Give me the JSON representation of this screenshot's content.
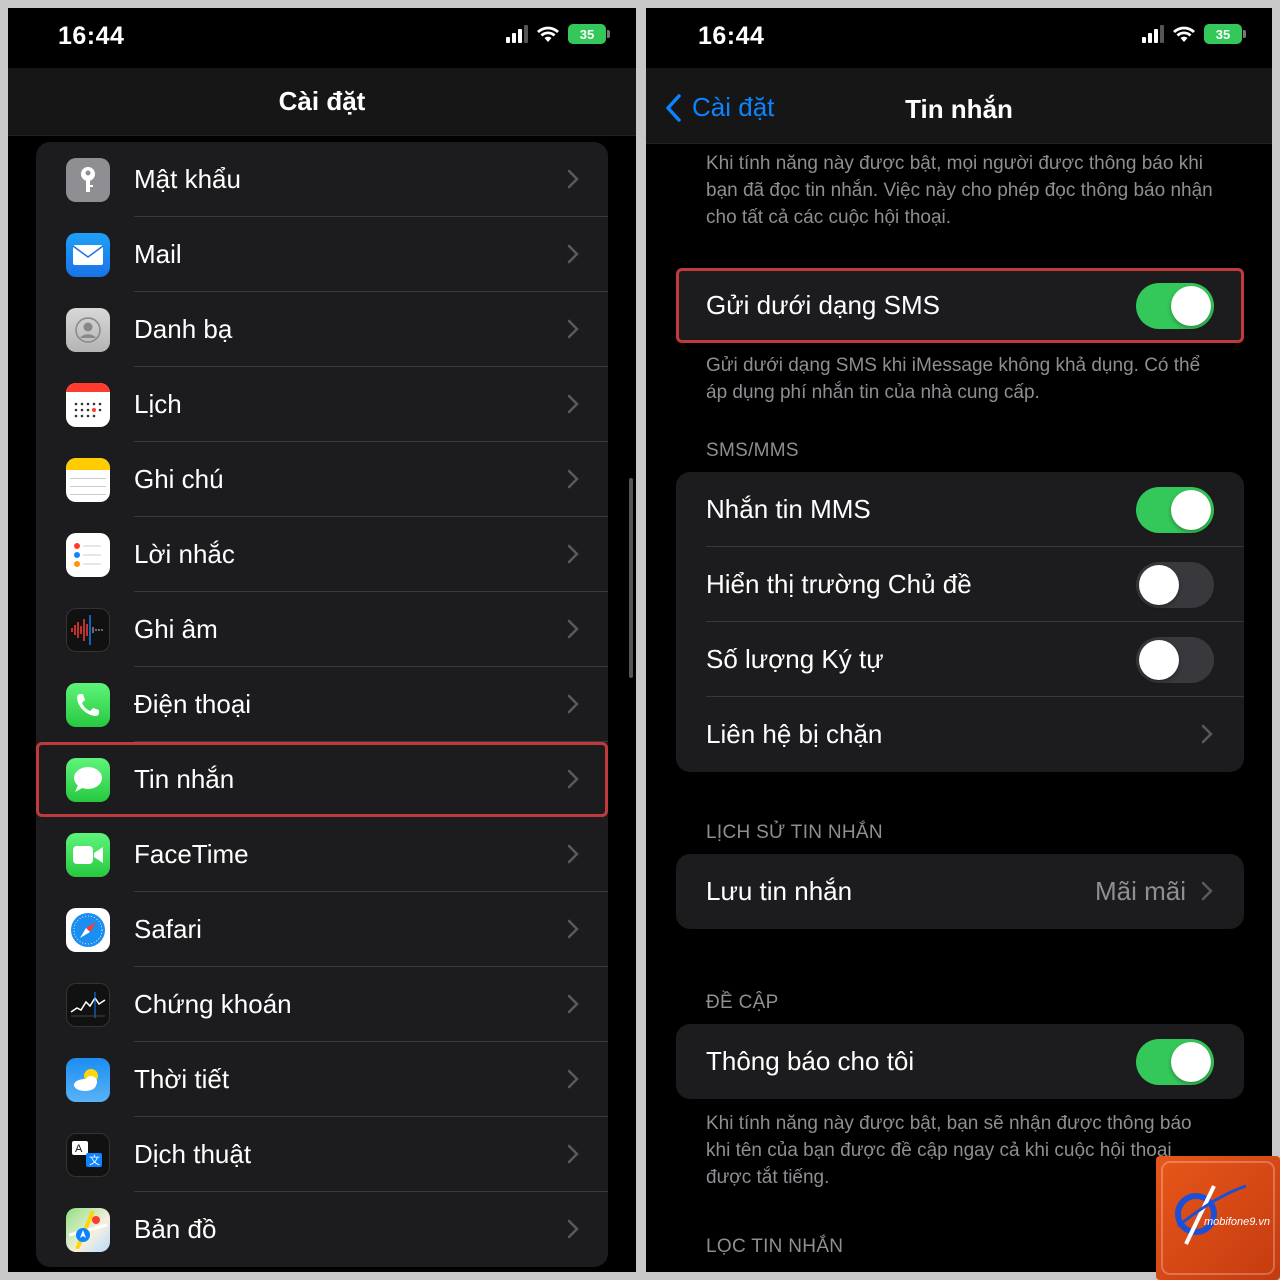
{
  "left": {
    "status": {
      "time": "16:44",
      "battery": "35"
    },
    "nav_title": "Cài đặt",
    "items": [
      {
        "label": "Mật khẩu",
        "icon": "key-icon"
      },
      {
        "label": "Mail",
        "icon": "mail-icon"
      },
      {
        "label": "Danh bạ",
        "icon": "contacts-icon"
      },
      {
        "label": "Lịch",
        "icon": "calendar-icon"
      },
      {
        "label": "Ghi chú",
        "icon": "notes-icon"
      },
      {
        "label": "Lời nhắc",
        "icon": "reminders-icon"
      },
      {
        "label": "Ghi âm",
        "icon": "voice-memos-icon"
      },
      {
        "label": "Điện thoại",
        "icon": "phone-icon"
      },
      {
        "label": "Tin nhắn",
        "icon": "messages-icon"
      },
      {
        "label": "FaceTime",
        "icon": "facetime-icon"
      },
      {
        "label": "Safari",
        "icon": "safari-icon"
      },
      {
        "label": "Chứng khoán",
        "icon": "stocks-icon"
      },
      {
        "label": "Thời tiết",
        "icon": "weather-icon"
      },
      {
        "label": "Dịch thuật",
        "icon": "translate-icon"
      },
      {
        "label": "Bản đồ",
        "icon": "maps-icon"
      }
    ]
  },
  "right": {
    "status": {
      "time": "16:44",
      "battery": "35"
    },
    "back_label": "Cài đặt",
    "nav_title": "Tin nhắn",
    "read_receipts_note": "Khi tính năng này được bật, mọi người được thông báo khi bạn đã đọc tin nhắn. Việc này cho phép đọc thông báo nhận cho tất cả các cuộc hội thoại.",
    "send_as_sms": {
      "label": "Gửi dưới dạng SMS",
      "on": true
    },
    "send_as_sms_note": "Gửi dưới dạng SMS khi iMessage không khả dụng. Có thể áp dụng phí nhắn tin của nhà cung cấp.",
    "sms_mms_header": "SMS/MMS",
    "mms_messaging": {
      "label": "Nhắn tin MMS",
      "on": true
    },
    "show_subject": {
      "label": "Hiển thị trường Chủ đề",
      "on": false
    },
    "char_count": {
      "label": "Số lượng Ký tự",
      "on": false
    },
    "blocked_contacts": {
      "label": "Liên hệ bị chặn"
    },
    "history_header": "LỊCH SỬ TIN NHẮN",
    "keep_messages": {
      "label": "Lưu tin nhắn",
      "value": "Mãi mãi"
    },
    "mentions_header": "ĐỀ CẬP",
    "notify_me": {
      "label": "Thông báo cho tôi",
      "on": true
    },
    "notify_me_note": "Khi tính năng này được bật, bạn sẽ nhận được thông báo khi tên của bạn được đề cập ngay cả khi cuộc hội thoại được tắt tiếng.",
    "filter_header": "LỌC TIN NHẮN"
  },
  "watermark": {
    "text": "mobifone9.vn"
  },
  "colors": {
    "accent": "#0a84ff",
    "toggle_on": "#34c759",
    "highlight": "#c0393d"
  }
}
